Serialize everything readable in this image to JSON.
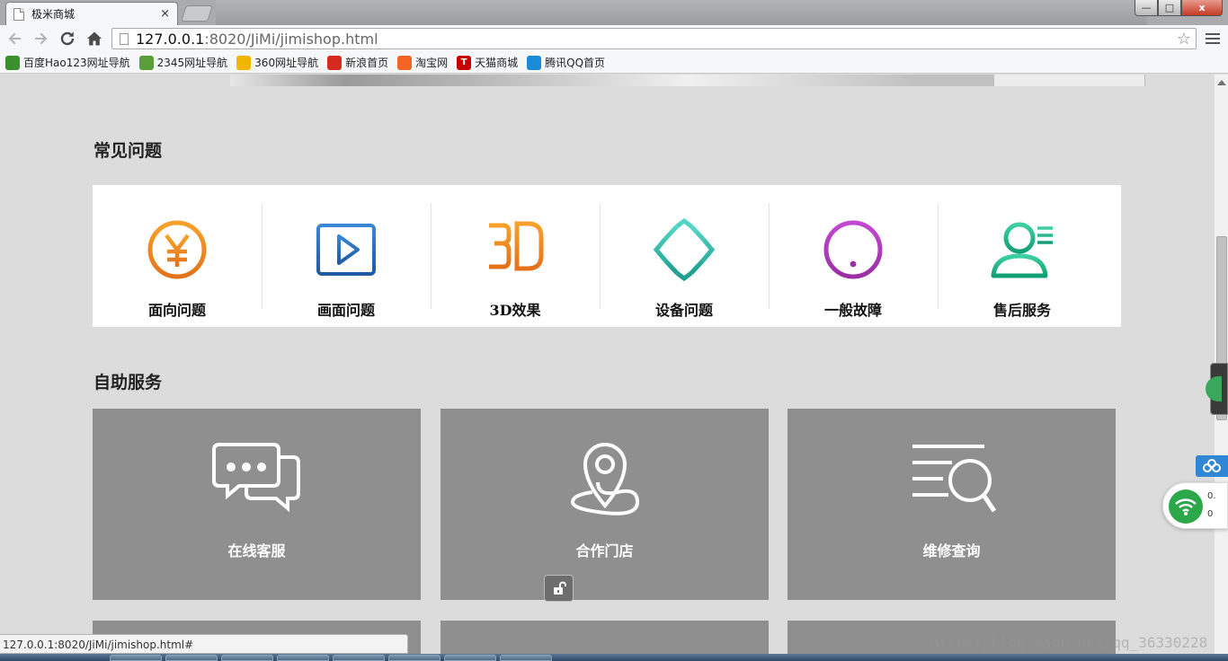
{
  "browser": {
    "tab_title": "极米商城",
    "tab_close": "×",
    "url_host": "127.0.0.1",
    "url_rest": ":8020/JiMi/jimishop.html",
    "window_buttons": {
      "minimize": "—",
      "maximize": "□",
      "close": "x"
    },
    "icons": {
      "back": "arrow-left-icon",
      "forward": "arrow-right-icon",
      "reload": "reload-icon",
      "home": "home-icon",
      "star": "star-icon",
      "menu": "hamburger-menu-icon"
    },
    "bookmarks": [
      {
        "label": "百度Hao123网址导航",
        "icon": "hao123-icon",
        "color": "#3a8f2e",
        "glyph": ""
      },
      {
        "label": "2345网址导航",
        "icon": "2345-icon",
        "color": "#5a9e3c",
        "glyph": ""
      },
      {
        "label": "360网址导航",
        "icon": "360-icon",
        "color": "#f2b600",
        "glyph": ""
      },
      {
        "label": "新浪首页",
        "icon": "sina-weibo-icon",
        "color": "#d52b1e",
        "glyph": ""
      },
      {
        "label": "淘宝网",
        "icon": "taobao-icon",
        "color": "#f26522",
        "glyph": ""
      },
      {
        "label": "天猫商城",
        "icon": "tmall-icon",
        "color": "#c40000",
        "glyph": "T"
      },
      {
        "label": "腾讯QQ首页",
        "icon": "qq-icon",
        "color": "#1a8bd8",
        "glyph": ""
      }
    ]
  },
  "page": {
    "faq_title": "常见问题",
    "faq_items": [
      {
        "label": "面向问题",
        "icon": "yuan-coin-icon",
        "color": "#f08a1c"
      },
      {
        "label": "画面问题",
        "icon": "play-video-icon",
        "color": "#2c6fbf"
      },
      {
        "label": "3D效果",
        "icon": "3d-text-icon",
        "color": "#f08a1c"
      },
      {
        "label": "设备问题",
        "icon": "diamond-device-icon",
        "color": "#2fbfae"
      },
      {
        "label": "一般故障",
        "icon": "exclamation-circle-icon",
        "color": "#b03fb8"
      },
      {
        "label": "售后服务",
        "icon": "person-service-icon",
        "color": "#28b68c"
      }
    ],
    "self_service_title": "自助服务",
    "services": [
      {
        "label": "在线客服",
        "icon": "chat-bubbles-icon"
      },
      {
        "label": "合作门店",
        "icon": "location-pin-icon"
      },
      {
        "label": "维修查询",
        "icon": "search-list-icon"
      }
    ]
  },
  "status_url": "127.0.0.1:8020/JiMi/jimishop.html#",
  "watermark": "http://blog.csdn.net/qq_36330228",
  "net_widget": {
    "up": "0.",
    "down": "0"
  }
}
